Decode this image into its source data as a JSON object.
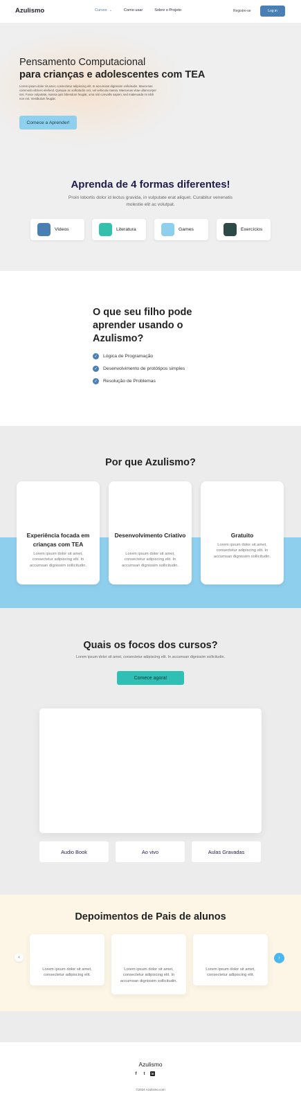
{
  "header": {
    "logo": "Azulismo",
    "nav": [
      "Cursos",
      "Como usar",
      "Sobre o Projeto"
    ],
    "register": "Registre-se",
    "login": "Log in"
  },
  "hero": {
    "title_line1": "Pensamento Computacional",
    "title_line2": "para crianças e adolescentes com TEA",
    "text": "Lorem ipsum dolor sit amet, consectetur adipiscing elit. In accumsan dignissim sollicitudin. Maecenas commodo ultrices eleifend. Quisque ac sollicitudin orci, vel vehicula massa. Maecenas vitae ullamcorper nisi. Fusce vulputate, massa quis bibendum feugiat, urna nisl convallis sapien, sed malesuada mi nibh non est. Vestibulum feugiat.",
    "cta": "Comece a Aprender!"
  },
  "formas": {
    "title": "Aprenda de 4 formas diferentes!",
    "subtitle": "Proin lobortis dolor id lectus gravida, in vulputate erat aliquet. Curabitur venenatis molestie elit ac volutpat.",
    "items": [
      {
        "label": "Videos",
        "color": "#4a7fb3"
      },
      {
        "label": "Literatura",
        "color": "#34c0ac"
      },
      {
        "label": "Games",
        "color": "#8fcfee"
      },
      {
        "label": "Exercícios",
        "color": "#2e4a48"
      }
    ]
  },
  "aprender": {
    "title": "O que seu filho pode aprender usando o Azulismo?",
    "items": [
      "Lógica de Programação",
      "Desenvolvimento de protótipos simples",
      "Resolução de Problemas"
    ]
  },
  "porque": {
    "title": "Por que Azulismo?",
    "cards": [
      {
        "title": "Experiência focada em crianças com TEA",
        "text": "Lorem ipsum dolor sit amet, consectetur adipiscing elit. In accumsan dignissim sollicitudin."
      },
      {
        "title": "Desenvolvimento Criativo",
        "text": "Lorem ipsum dolor sit amet, consectetur adipiscing elit. In accumsan dignissim sollicitudin."
      },
      {
        "title": "Gratuito",
        "text": "Lorem ipsum dolor sit amet, consectetur adipiscing elit. In accumsan dignissim sollicitudin."
      }
    ]
  },
  "focos": {
    "title": "Quais os focos dos cursos?",
    "subtitle": "Lorem ipsum dolor sit amet, consectetur adipiscing elit. In accumsan dignissim sollicitudin.",
    "cta": "Comece agora!",
    "tabs": [
      "Audio Book",
      "Ao vivo",
      "Aulas Gravadas"
    ]
  },
  "depoimentos": {
    "title": "Depoimentos de Pais de alunos",
    "cards": [
      "Lorem ipsum dolor sit amet, consectetur adipiscing elit.",
      "Lorem ipsum dolor sit amet, consectetur adipiscing elit. In accumsan dignissim sollicitudin.",
      "Lorem ipsum dolor sit amet, consectetur adipiscing elit."
    ],
    "prev": "‹",
    "next": "›"
  },
  "footer": {
    "logo": "Azulismo",
    "social": [
      "facebook-icon",
      "twitter-icon",
      "linkedin-icon"
    ],
    "copyright": "©2024 Azulismo.com"
  }
}
